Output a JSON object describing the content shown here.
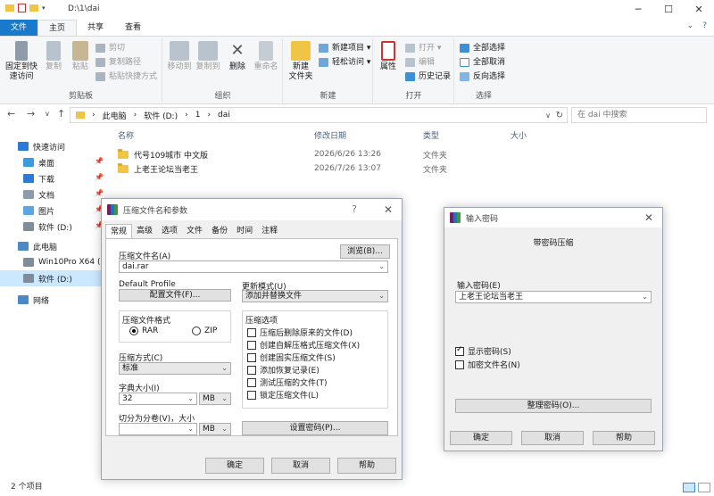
{
  "window": {
    "title": "D:\\1\\dai"
  },
  "tabs": [
    "文件",
    "主页",
    "共享",
    "查看"
  ],
  "ribbon": {
    "clipboard": {
      "pin": "固定到快\n速访问",
      "copy": "复制",
      "paste": "粘贴",
      "cut": "剪切",
      "copy_path": "复制路径",
      "paste_shortcut": "粘贴快捷方式",
      "label": "剪贴板"
    },
    "organize": {
      "move_to": "移动到",
      "copy_to": "复制到",
      "delete": "删除",
      "rename": "重命名",
      "label": "组织"
    },
    "new": {
      "new_folder": "新建\n文件夹",
      "new_item": "新建项目",
      "easy_access": "轻松访问",
      "label": "新建"
    },
    "open": {
      "properties": "属性",
      "open": "打开",
      "edit": "编辑",
      "history": "历史记录",
      "label": "打开"
    },
    "select": {
      "select_all": "全部选择",
      "select_none": "全部取消",
      "invert": "反向选择",
      "label": "选择"
    }
  },
  "address": {
    "crumbs": [
      "此电脑",
      "软件 (D:)",
      "1",
      "dai"
    ],
    "search_placeholder": "在 dai 中搜索"
  },
  "nav": [
    {
      "label": "快速访问",
      "color": "#2b7bd6"
    },
    {
      "label": "桌面",
      "color": "#3a9be0"
    },
    {
      "label": "下载",
      "color": "#2b7bd6"
    },
    {
      "label": "文档",
      "color": "#8c9aad"
    },
    {
      "label": "图片",
      "color": "#5aa7e6"
    },
    {
      "label": "软件 (D:)",
      "color": "#7f8c9a"
    },
    {
      "label": "此电脑",
      "color": "#4a88c7"
    },
    {
      "label": "Win10Pro X64 (C:",
      "color": "#7f8c9a"
    },
    {
      "label": "软件 (D:)",
      "color": "#7f8c9a"
    },
    {
      "label": "网络",
      "color": "#4a88c7"
    }
  ],
  "columns": {
    "name": "名称",
    "date": "修改日期",
    "type": "类型",
    "size": "大小"
  },
  "files": [
    {
      "name": "代号109城市 中文版",
      "date": "2026/6/26 13:26",
      "type": "文件夹"
    },
    {
      "name": "上老王论坛当老王",
      "date": "2026/7/26 13:07",
      "type": "文件夹"
    }
  ],
  "status": "2 个项目",
  "archive_dialog": {
    "title": "压缩文件名和参数",
    "tabs": [
      "常规",
      "高级",
      "选项",
      "文件",
      "备份",
      "时间",
      "注释"
    ],
    "archive_name_label": "压缩文件名(A)",
    "browse": "浏览(B)...",
    "archive_name": "dai.rar",
    "default_profile": "Default Profile",
    "profiles_btn": "配置文件(F)...",
    "update_mode_label": "更新模式(U)",
    "update_mode": "添加并替换文件",
    "format_label": "压缩文件格式",
    "fmt_rar": "RAR",
    "fmt_zip": "ZIP",
    "method_label": "压缩方式(C)",
    "method": "标准",
    "dict_label": "字典大小(I)",
    "dict": "32",
    "dict_unit": "MB",
    "split_label": "切分为分卷(V)，大小",
    "split_unit": "MB",
    "options_label": "压缩选项",
    "options": [
      "压缩后删除原来的文件(D)",
      "创建自解压格式压缩文件(X)",
      "创建固实压缩文件(S)",
      "添加恢复记录(E)",
      "测试压缩的文件(T)",
      "锁定压缩文件(L)"
    ],
    "set_password": "设置密码(P)...",
    "ok": "确定",
    "cancel": "取消",
    "help": "帮助"
  },
  "password_dialog": {
    "title": "输入密码",
    "heading": "带密码压缩",
    "enter_label": "输入密码(E)",
    "password": "上老王论坛当老王",
    "show_password": "显示密码(S)",
    "encrypt_names": "加密文件名(N)",
    "organize": "整理密码(O)...",
    "ok": "确定",
    "cancel": "取消",
    "help": "帮助"
  }
}
